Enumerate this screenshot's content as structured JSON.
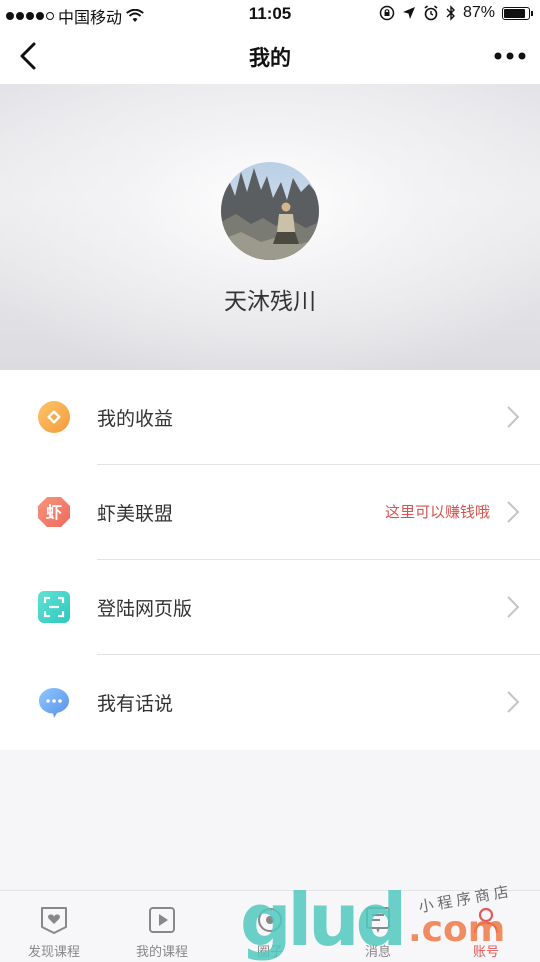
{
  "status_bar": {
    "carrier": "中国移动",
    "time": "11:05",
    "battery": "87%"
  },
  "nav": {
    "title": "我的",
    "back_icon": "chevron-left-icon",
    "more_icon": "more-dots-icon"
  },
  "profile": {
    "name": "天沐残川"
  },
  "menu": {
    "items": [
      {
        "label": "我的收益",
        "hint": "",
        "icon": "earnings-icon",
        "color": "#f7a64a"
      },
      {
        "label": "虾美联盟",
        "hint": "这里可以赚钱哦",
        "icon": "xia-alliance-icon",
        "icon_text": "虾",
        "color": "#f07a6a"
      },
      {
        "label": "登陆网页版",
        "hint": "",
        "icon": "scan-icon",
        "color": "#3fd6c6"
      },
      {
        "label": "我有话说",
        "hint": "",
        "icon": "chat-bubble-icon",
        "color": "#6aa8f0"
      }
    ]
  },
  "tabbar": {
    "tabs": [
      {
        "label": "发现课程",
        "icon": "heart-shield-icon"
      },
      {
        "label": "我的课程",
        "icon": "play-icon"
      },
      {
        "label": "圈子",
        "icon": "circle-icon"
      },
      {
        "label": "消息",
        "icon": "message-icon"
      },
      {
        "label": "账号",
        "icon": "person-icon"
      }
    ],
    "active_index": 4,
    "active_color": "#e05a5a"
  },
  "watermark": {
    "main": "glud",
    "domain": ".com",
    "script": "小程序商店"
  }
}
